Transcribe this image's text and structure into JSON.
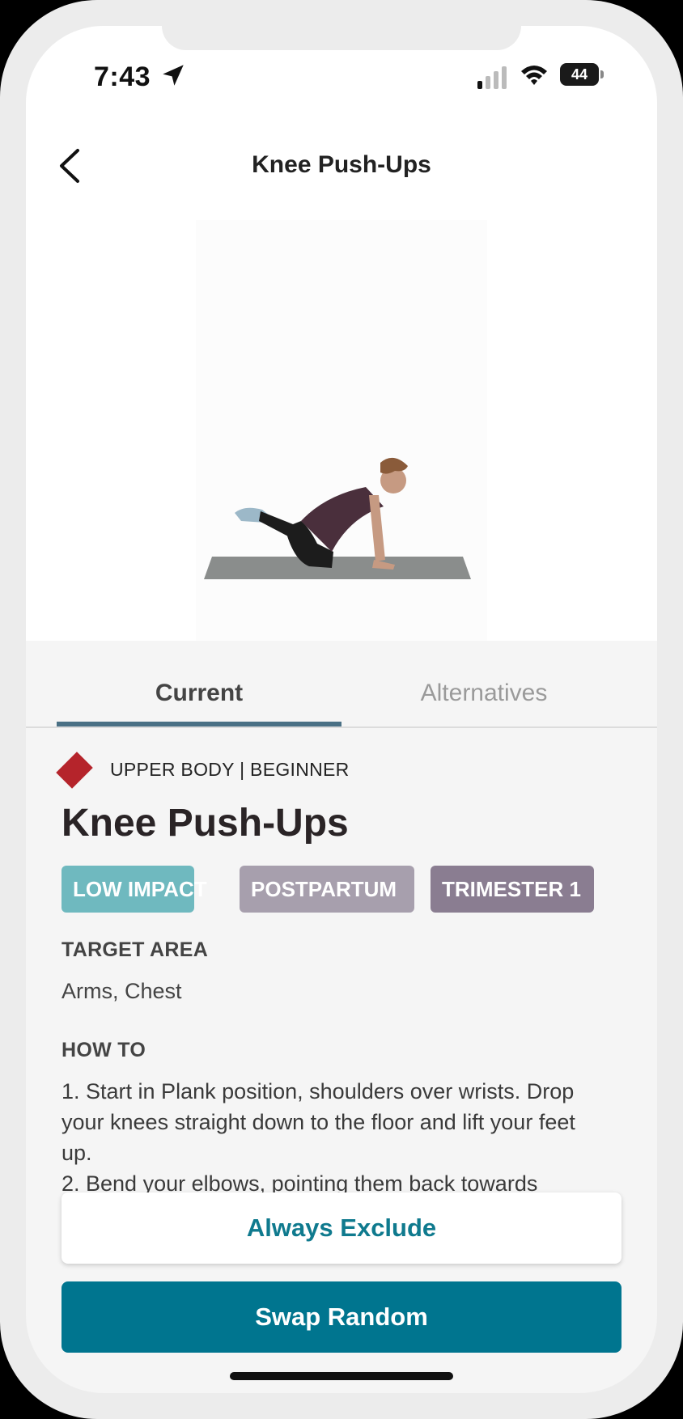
{
  "status_bar": {
    "time": "7:43",
    "location_icon": "location-arrow-icon",
    "signal_icon": "cellular-signal-icon",
    "wifi_icon": "wifi-icon",
    "battery_level": "44"
  },
  "header": {
    "back_icon": "chevron-left-icon",
    "title": "Knee Push-Ups"
  },
  "tabs": [
    {
      "label": "Current",
      "active": true
    },
    {
      "label": "Alternatives",
      "active": false
    }
  ],
  "details": {
    "category_icon": "red-diamond-icon",
    "category": "UPPER BODY | BEGINNER",
    "name": "Knee Push-Ups",
    "tags": [
      {
        "label": "LOW IMPACT",
        "color": "#6fb9bf"
      },
      {
        "label": "POSTPARTUM",
        "color": "#a79fad"
      },
      {
        "label": "TRIMESTER 1",
        "color": "#8a7d91"
      }
    ],
    "target_area_label": "TARGET AREA",
    "target_area_value": "Arms, Chest",
    "how_to_label": "HOW TO",
    "how_to_steps": [
      "1. Start in Plank position, shoulders over wrists. Drop your knees straight down to the floor and lift your feet up.",
      "2. Bend your elbows, pointing them back towards"
    ]
  },
  "actions": {
    "exclude_label": "Always Exclude",
    "swap_label": "Swap Random"
  },
  "colors": {
    "accent": "#00758f",
    "tab_underline": "#4a7085",
    "category_diamond": "#b5242b"
  }
}
